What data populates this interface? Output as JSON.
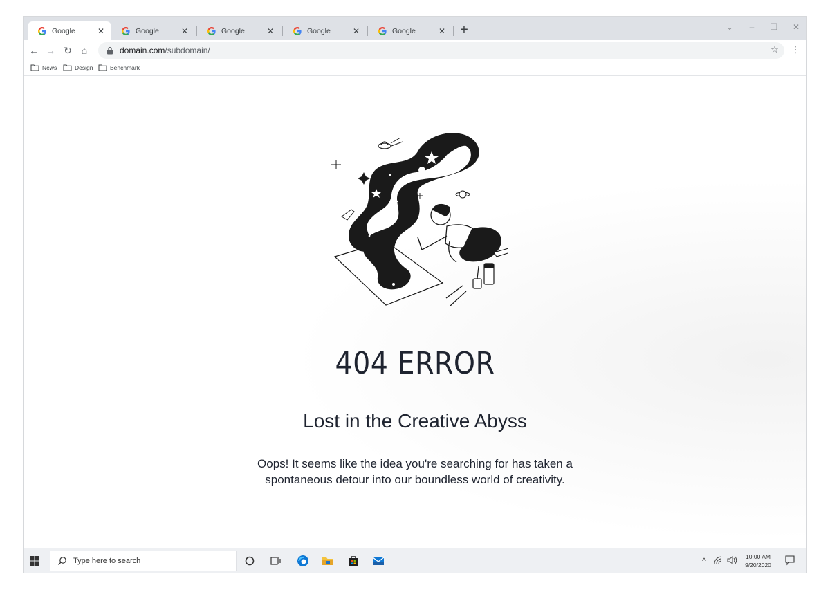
{
  "browser": {
    "tabs": [
      {
        "title": "Google",
        "close": "✕",
        "active": true
      },
      {
        "title": "Google",
        "close": "✕",
        "active": false
      },
      {
        "title": "Google",
        "close": "✕",
        "active": false
      },
      {
        "title": "Google",
        "close": "✕",
        "active": false
      },
      {
        "title": "Google",
        "close": "✕",
        "active": false
      }
    ],
    "new_tab": "+",
    "window_controls": {
      "dropdown": "⌄",
      "minimize": "–",
      "restore": "❐",
      "close": "✕"
    },
    "toolbar": {
      "back": "←",
      "forward": "→",
      "reload": "↻",
      "home": "⌂",
      "bookmark_star": "☆",
      "menu": "⋮"
    },
    "address": {
      "host": "domain.com",
      "path": "/subdomain/"
    },
    "bookmarks": [
      {
        "label": "News",
        "icon": "folder-icon"
      },
      {
        "label": "Design",
        "icon": "folder-icon"
      },
      {
        "label": "Benchmark",
        "icon": "folder-icon"
      }
    ]
  },
  "page": {
    "title": "404 ERROR",
    "subtitle": "Lost in the Creative Abyss",
    "body_line1": "Oops! It seems like the idea you're searching for has taken a",
    "body_line2": "spontaneous detour into our boundless world of creativity.",
    "illustration_icon": "space-painter-illustration"
  },
  "taskbar": {
    "search_placeholder": "Type here to search",
    "apps": [
      "cortana-icon",
      "task-view-icon",
      "edge-icon",
      "file-explorer-icon",
      "store-icon",
      "mail-icon"
    ],
    "tray": {
      "chevron": "^",
      "network": "wifi-icon",
      "volume": "volume-icon"
    },
    "time": "10:00 AM",
    "date": "9/20/2020"
  },
  "colors": {
    "tabstrip": "#dee1e6",
    "omnibox": "#f1f3f4",
    "text_dark": "#1f2430",
    "taskbar": "#eef0f3",
    "edge_blue": "#0f78d4",
    "explorer_yellow": "#f4c33e"
  }
}
